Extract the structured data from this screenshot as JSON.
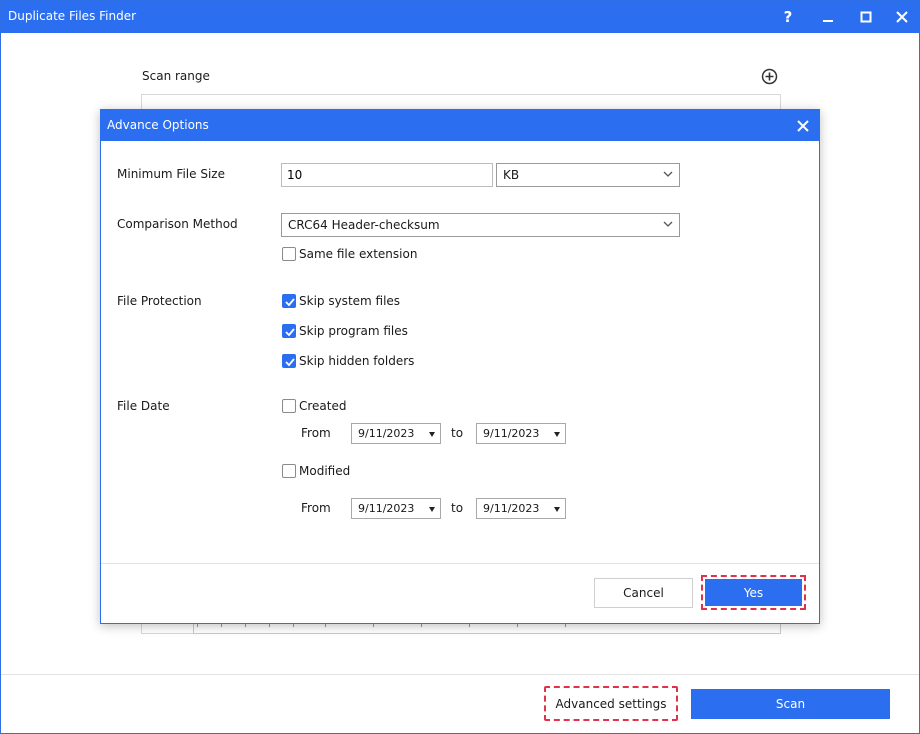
{
  "window": {
    "title": "Duplicate Files Finder",
    "help_label": "?",
    "scan_range_label": "Scan range",
    "advanced_settings_label": "Advanced settings",
    "scan_label": "Scan"
  },
  "dialog": {
    "title": "Advance Options",
    "min_file_size": {
      "label": "Minimum File Size",
      "value": "10",
      "unit": "KB"
    },
    "comparison": {
      "label": "Comparison Method",
      "method": "CRC64 Header-checksum",
      "same_extension_label": "Same file extension",
      "same_extension_checked": false
    },
    "protection": {
      "label": "File Protection",
      "items": [
        {
          "label": "Skip system files",
          "checked": true
        },
        {
          "label": "Skip program files",
          "checked": true
        },
        {
          "label": "Skip hidden folders",
          "checked": true
        }
      ]
    },
    "file_date": {
      "label": "File Date",
      "created": {
        "label": "Created",
        "checked": false,
        "from_label": "From",
        "to_label": "to",
        "from": "9/11/2023",
        "to": "9/11/2023"
      },
      "modified": {
        "label": "Modified",
        "checked": false,
        "from_label": "From",
        "to_label": "to",
        "from": "9/11/2023",
        "to": "9/11/2023"
      }
    },
    "cancel_label": "Cancel",
    "yes_label": "Yes"
  },
  "colors": {
    "accent": "#2b6ff0",
    "highlight": "#e0334a"
  }
}
